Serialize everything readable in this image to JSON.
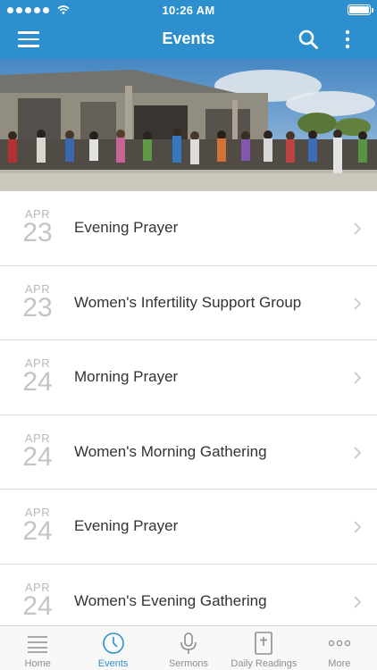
{
  "status_bar": {
    "time": "10:26 AM"
  },
  "nav": {
    "title": "Events"
  },
  "events": [
    {
      "month": "APR",
      "day": "23",
      "name": "Evening Prayer"
    },
    {
      "month": "APR",
      "day": "23",
      "name": "Women's Infertility Support Group"
    },
    {
      "month": "APR",
      "day": "24",
      "name": "Morning Prayer"
    },
    {
      "month": "APR",
      "day": "24",
      "name": "Women's Morning Gathering"
    },
    {
      "month": "APR",
      "day": "24",
      "name": "Evening Prayer"
    },
    {
      "month": "APR",
      "day": "24",
      "name": "Women's Evening Gathering"
    }
  ],
  "tabbar": {
    "items": [
      {
        "label": "Home",
        "icon": "list-icon",
        "active": false
      },
      {
        "label": "Events",
        "icon": "clock-icon",
        "active": true
      },
      {
        "label": "Sermons",
        "icon": "microphone-icon",
        "active": false
      },
      {
        "label": "Daily Readings",
        "icon": "bible-icon",
        "active": false
      },
      {
        "label": "More",
        "icon": "ellipsis-icon",
        "active": false
      }
    ]
  },
  "colors": {
    "accent": "#2d8fce",
    "tab_inactive": "#8e8e8e",
    "date_gray": "#c4c4c4"
  }
}
